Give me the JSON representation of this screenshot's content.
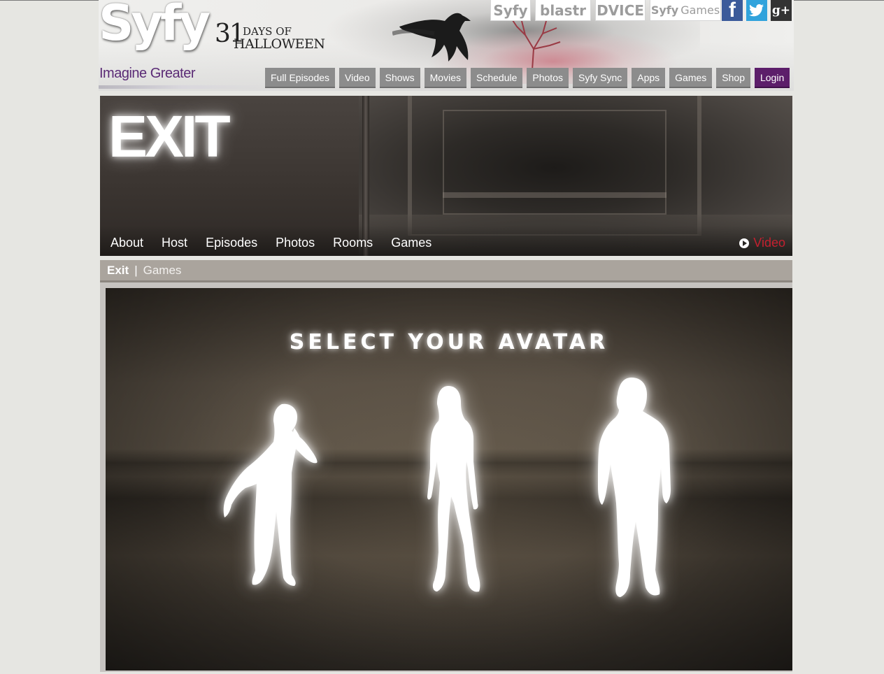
{
  "header": {
    "logo_text": "Syfy",
    "tagline": "Imagine Greater",
    "promo": {
      "number": "31",
      "line1": "DAYS OF",
      "line2": "HALLOWEEN"
    }
  },
  "network": {
    "syfy": "Syfy",
    "blastr": "blastr",
    "dvice": "DVICE",
    "games_brand": "Syfy",
    "games_label": "Games"
  },
  "social": {
    "facebook": "f",
    "twitter": "t",
    "googleplus": "g+"
  },
  "main_nav": {
    "items": [
      "Full Episodes",
      "Video",
      "Shows",
      "Movies",
      "Schedule",
      "Photos",
      "Syfy Sync",
      "Apps",
      "Games",
      "Shop"
    ],
    "login": "Login"
  },
  "show": {
    "logo": "EXIT",
    "nav": [
      "About",
      "Host",
      "Episodes",
      "Photos",
      "Rooms",
      "Games"
    ],
    "video_label": "Video"
  },
  "breadcrumb": {
    "root": "Exit",
    "separator": "|",
    "current": "Games"
  },
  "game": {
    "title": "SELECT YOUR AVATAR"
  },
  "colors": {
    "login_bg": "#5c1e6a",
    "video_link": "#c4202f",
    "tagline": "#5a2a75",
    "nav_bg": "#8c8c8c"
  }
}
